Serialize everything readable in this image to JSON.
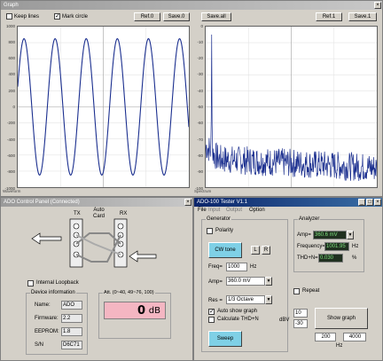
{
  "graph_window": {
    "title": "Graph",
    "keep_lines_label": "Keep lines",
    "keep_lines_checked": false,
    "mark_circle_label": "Mark circle",
    "mark_circle_checked": true,
    "ref0_label": "Ref.0",
    "save0_label": "Save.0",
    "save_all_label": "Save.all",
    "ref1_label": "Ref.1",
    "save1_label": "Save.1",
    "left_plot": {
      "y_ticks": [
        "1000",
        "800",
        "600",
        "400",
        "200",
        "0",
        "-200",
        "-400",
        "-600",
        "-800",
        "-1000"
      ],
      "bottom_label": "Waveform"
    },
    "right_plot": {
      "y_ticks": [
        "0",
        "-10",
        "-20",
        "-30",
        "-40",
        "-50",
        "-60",
        "-70",
        "-80",
        "-90",
        "-100"
      ],
      "bottom_label": "Spectrum"
    }
  },
  "chart_data": [
    {
      "type": "line",
      "ylim": [
        -1000,
        1000
      ],
      "series": [
        {
          "cycles": 5.5,
          "amplitude": 850
        }
      ]
    },
    {
      "type": "line",
      "ylim": [
        -100,
        0
      ],
      "series": [
        {
          "peak_db": -5,
          "noise_floor_db": -82
        }
      ]
    }
  ],
  "control_window": {
    "title": "ADO Control Panel (Connected)",
    "tx_label": "TX",
    "auto_card_label": "Auto\nCard",
    "rx_label": "RX",
    "internal_loopback_label": "Internal Loopback",
    "device_info_title": "Device information",
    "name_label": "Name:",
    "name_value": "ADO",
    "firmware_label": "Firmware:",
    "firmware_value": "2.2",
    "eeprom_label": "EEPROM:",
    "eeprom_value": "1.8",
    "sn_label": "S/N",
    "sn_value": "D6C71",
    "att_title": "Att. (0~40, 49~76, 100)",
    "att_value": "0",
    "att_unit": "dB"
  },
  "tester_window": {
    "title": "ADO-100 Tester V1.1",
    "menu": [
      "File",
      "Input",
      "Output",
      "Option"
    ],
    "generator_title": "Generator",
    "polarity_label": "Polarity",
    "cw_tone_label": "CW tone",
    "l_label": "L",
    "r_label": "R",
    "freq_label": "Freq=",
    "freq_value": "1000",
    "freq_unit": "Hz",
    "amp_label": "Amp=",
    "amp_value": "360.0 mV",
    "res_label": "Res =",
    "res_value": "1/3 Octave",
    "auto_show_graph_label": "Auto show graph",
    "calc_thd_label": "Calculate THD+N",
    "sweep_label": "Sweep",
    "analyzer_title": "Analyzer",
    "an_amp_label": "Amp=",
    "an_amp_value": "360.6 mV",
    "frequency_label": "Frequency=",
    "frequency_value": "1001.95",
    "frequency_unit": "Hz",
    "thdn_label": "THD+N=",
    "thdn_value": "0.030",
    "thdn_unit": "%",
    "repeat_label": "Repeat",
    "dbv_label": "dBV",
    "dbv_top": "10",
    "dbv_bottom": "-30",
    "show_graph_label": "Show graph",
    "hz_from": "200",
    "hz_to": "4000",
    "hz_label": "Hz"
  }
}
